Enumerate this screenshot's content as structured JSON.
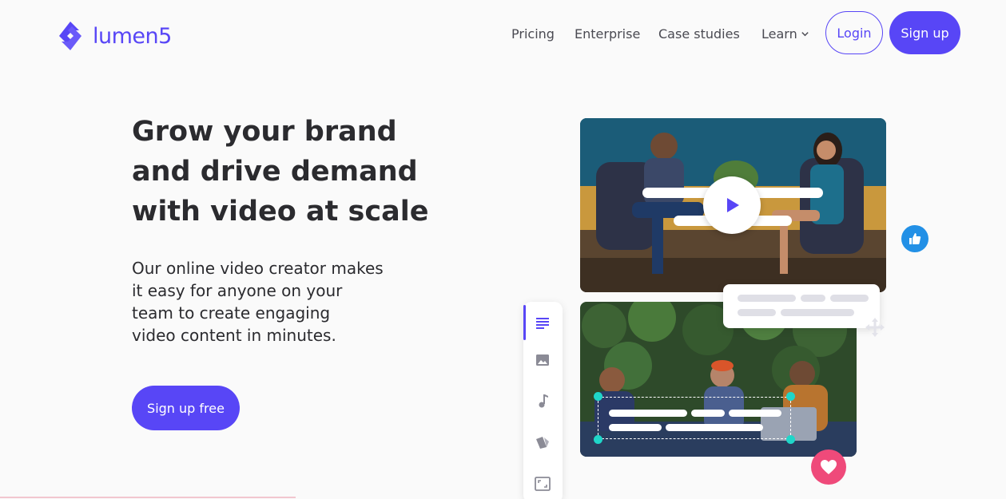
{
  "brand": {
    "name": "lumen5",
    "accent": "#5846f6"
  },
  "nav": {
    "links": [
      "Pricing",
      "Enterprise",
      "Case studies",
      "Learn"
    ],
    "login_label": "Login",
    "signup_label": "Sign up"
  },
  "hero": {
    "title_lines": [
      "Grow your brand",
      "and drive demand",
      "with video at scale"
    ],
    "subtitle_lines": [
      "Our online video creator makes",
      "it easy for anyone on your",
      "team to create engaging",
      "video content in minutes."
    ],
    "cta_label": "Sign up free"
  },
  "editor_tools": [
    "text-icon",
    "image-icon",
    "music-icon",
    "style-icon",
    "resize-icon"
  ],
  "colors": {
    "like": "#2290e6",
    "heart": "#ef4a7a",
    "handle": "#1fd6c9"
  }
}
